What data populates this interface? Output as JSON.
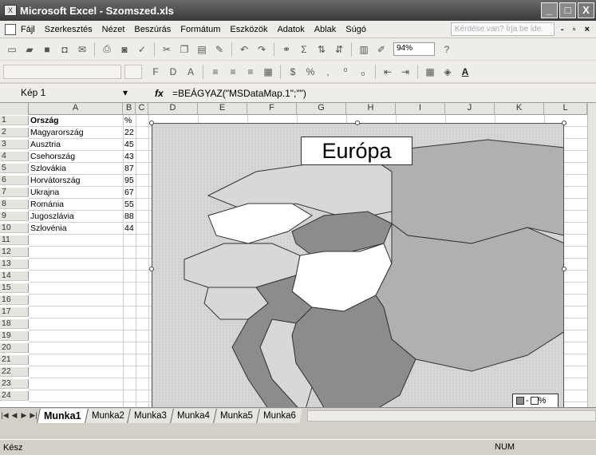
{
  "window": {
    "title": "Microsoft Excel - Szomszed.xls",
    "min": "_",
    "max": "□",
    "close": "X"
  },
  "menu": {
    "items": [
      "Fájl",
      "Szerkesztés",
      "Nézet",
      "Beszúrás",
      "Formátum",
      "Eszközök",
      "Adatok",
      "Ablak",
      "Súgó"
    ],
    "help_placeholder": "Kérdése van? Írja be ide.",
    "mdi_controls": "- ▫ ×"
  },
  "toolbar": {
    "zoom": "94%"
  },
  "formula_bar": {
    "name_box": "Kép 1",
    "fx": "fx",
    "formula": "=BEÁGYAZ(\"MSDataMap.1\";\"\")"
  },
  "grid": {
    "columns": [
      "A",
      "B",
      "C",
      "D",
      "E",
      "F",
      "G",
      "H",
      "I",
      "J",
      "K",
      "L"
    ],
    "rows": [
      "1",
      "2",
      "3",
      "4",
      "5",
      "6",
      "7",
      "8",
      "9",
      "10",
      "11",
      "12",
      "13",
      "14",
      "15",
      "16",
      "17",
      "18",
      "19",
      "20",
      "21",
      "22",
      "23",
      "24"
    ],
    "header": {
      "country": "Ország",
      "percent": "%"
    },
    "data": [
      {
        "country": "Magyarország",
        "value": "22"
      },
      {
        "country": "Ausztria",
        "value": "45"
      },
      {
        "country": "Csehország",
        "value": "43"
      },
      {
        "country": "Szlovákia",
        "value": "87"
      },
      {
        "country": "Horvátország",
        "value": "95"
      },
      {
        "country": "Ukrajna",
        "value": "67"
      },
      {
        "country": "Románia",
        "value": "55"
      },
      {
        "country": "Jugoszlávia",
        "value": "88"
      },
      {
        "country": "Szlovénia",
        "value": "44"
      }
    ]
  },
  "map": {
    "title": "Európa",
    "legend": "%",
    "colors": {
      "high": "#8c8c8c",
      "mid": "#b0b0b0",
      "low": "#d8d8d8",
      "lowest": "#ffffff",
      "sea": "#d6d6d6"
    }
  },
  "sheets": {
    "active": "Munka1",
    "tabs": [
      "Munka1",
      "Munka2",
      "Munka3",
      "Munka4",
      "Munka5",
      "Munka6"
    ]
  },
  "status": {
    "left": "Kész",
    "num": "NUM"
  }
}
